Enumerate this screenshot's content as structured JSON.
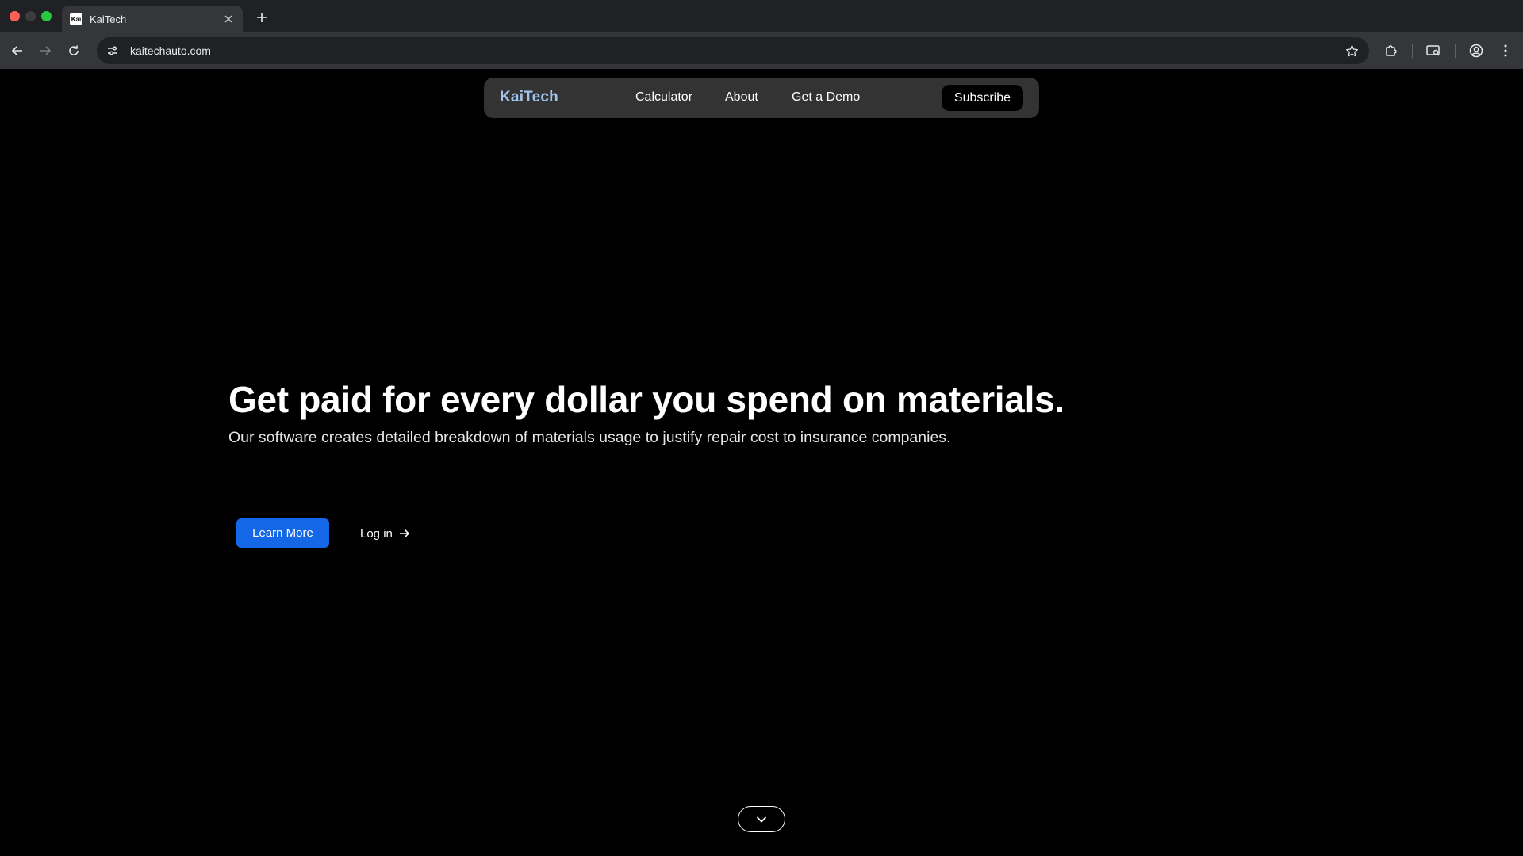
{
  "browser": {
    "tab": {
      "title": "KaiTech",
      "favicon_icon": "kaitech-favicon",
      "favicon_text": "Kai"
    },
    "address_bar": {
      "url": "kaitechauto.com"
    },
    "icons": {
      "back": "arrow-left-icon",
      "forward": "arrow-right-icon",
      "reload": "reload-icon",
      "site_info": "tune-icon",
      "bookmark": "star-icon",
      "extensions": "puzzle-icon",
      "media": "cast-search-icon",
      "profile": "profile-icon",
      "menu": "kebab-menu-icon",
      "new_tab": "plus-icon",
      "close_tab": "close-icon"
    }
  },
  "site_nav": {
    "brand": "KaiTech",
    "links": [
      "Calculator",
      "About",
      "Get a Demo"
    ],
    "subscribe_label": "Subscribe"
  },
  "hero": {
    "title": "Get paid for every dollar you spend on materials.",
    "subtitle": "Our software creates detailed breakdown of materials usage to justify repair cost to insurance companies.",
    "primary_cta": "Learn More",
    "secondary_cta": "Log in",
    "scroll_icon": "chevron-down-icon"
  },
  "colors": {
    "page_background": "#000000",
    "nav_background": "#333334",
    "brand_color": "#9fc4ec",
    "primary_button": "#1467e6",
    "browser_tabstrip": "#202124",
    "browser_toolbar": "#35363a"
  }
}
